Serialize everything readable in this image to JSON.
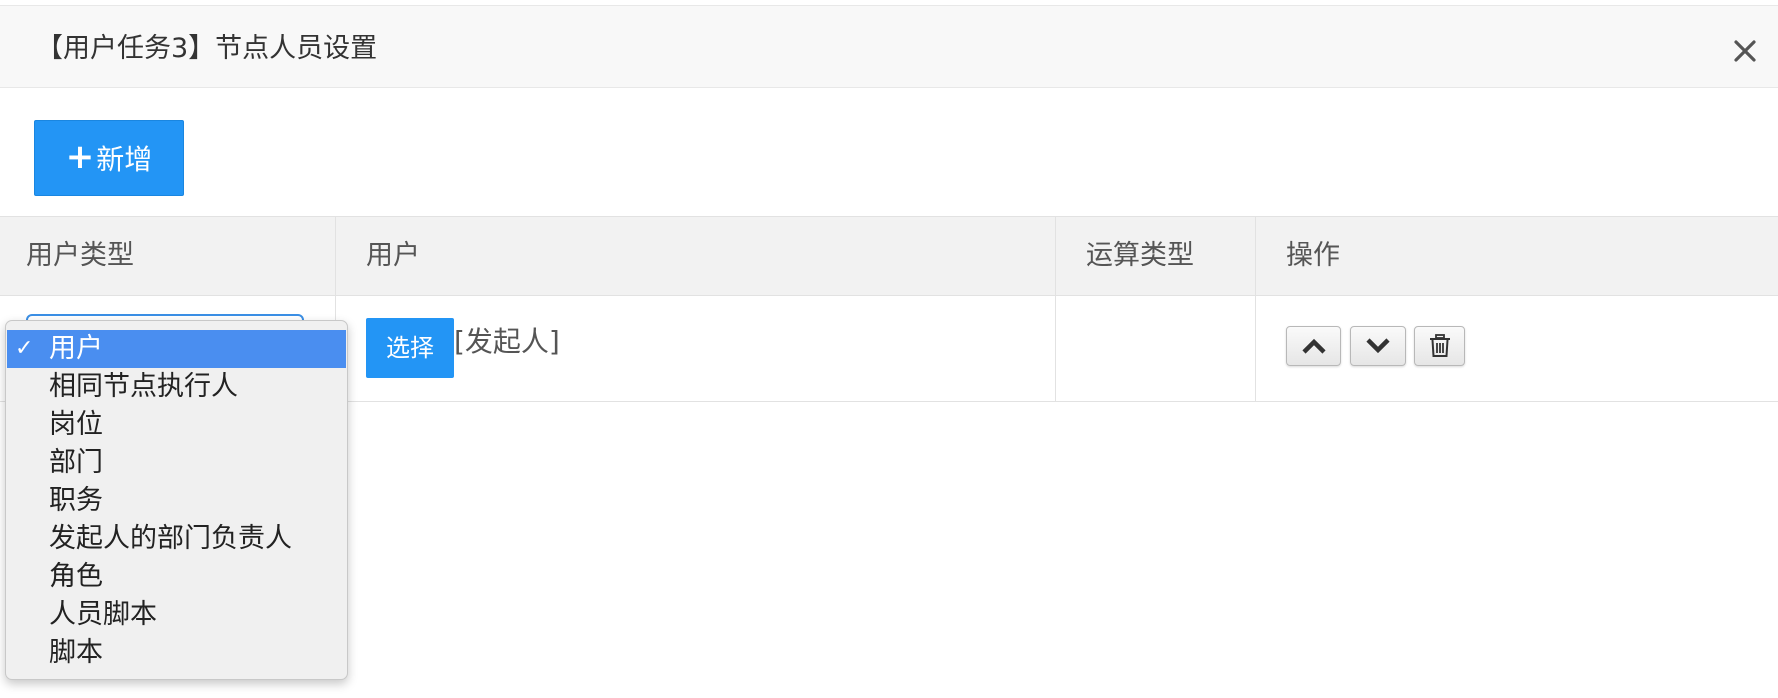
{
  "dialog": {
    "title": "【用户任务3】节点人员设置"
  },
  "toolbar": {
    "add_label": "新增",
    "add_icon": "plus-icon"
  },
  "table": {
    "headers": [
      "用户类型",
      "用户",
      "运算类型",
      "操作"
    ],
    "rows": [
      {
        "user_type": "用户",
        "select_label": "选择",
        "user_value": "[发起人]",
        "operation_type": ""
      }
    ]
  },
  "dropdown": {
    "options": [
      "用户",
      "相同节点执行人",
      "岗位",
      "部门",
      "职务",
      "发起人的部门负责人",
      "角色",
      "人员脚本",
      "脚本"
    ],
    "selected": "用户",
    "check_glyph": "✓"
  },
  "colors": {
    "primary": "#2395f5",
    "selected_option": "#4a8ef0",
    "header_bg": "#f8f8f8",
    "table_header_bg": "#f2f2f2"
  }
}
